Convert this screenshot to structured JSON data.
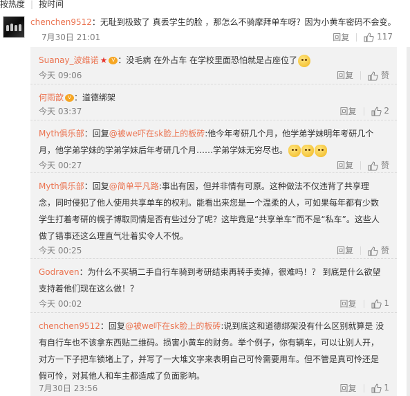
{
  "sort": {
    "by_hot": "按热度",
    "by_time": "按时间"
  },
  "main_comment": {
    "user": "chenchen9512",
    "text": "：无耻到极致了 真丢学生的脸 ，那怎么不骑摩拜单车呀？因为小黄车密码不会变。",
    "time": "7月30日 21:01",
    "reply_label": "回复",
    "likes": "117"
  },
  "replies": [
    {
      "user": "Suanay_波维诺",
      "badges": [
        "star-badge",
        "vip-badge"
      ],
      "text": "：没毛病 在外占车 在学校里面恐怕就是占座位了",
      "emoji_count": 1,
      "time": "今天 09:06",
      "reply_label": "回复",
      "likes_label": "赞"
    },
    {
      "user": "何雨歆",
      "badges": [
        "vip-badge"
      ],
      "text": "：道德绑架",
      "time": "今天 03:37",
      "reply_label": "回复",
      "likes_label": "2"
    },
    {
      "user": "Myth俱乐部",
      "reply_prefix": "：回复",
      "mention": "@被we吓在sk脸上的板砖",
      "text": ":他今年考研几个月，他学弟学妹明年考研几个月，他学弟学妹的学弟学妹后年考研几个月……学弟学妹无穷尽也。",
      "emoji_count": 3,
      "time": "今天 00:27",
      "reply_label": "回复",
      "likes_label": "赞"
    },
    {
      "user": "Myth俱乐部",
      "reply_prefix": "：回复",
      "mention": "@简单平凡路",
      "text": ":事出有因，但并非情有可原。这种做法不仅违背了共享理念，同时侵犯了他人使用共享单车的权利。能看出来您是一个温柔的人，可如果每年都有少数学生打着考研的幌子博取同情是否有些过分了呢？这毕竟是“共享单车”而不是“私车”。这些人做了错事还这么理直气壮着实令人不悦。",
      "time": "今天 00:25",
      "reply_label": "回复",
      "likes_label": "赞"
    },
    {
      "user": "Godraven",
      "text": "：为什么不买辆二手自行车骑到考研结束再转手卖掉，很难吗！？ 到底是什么欲望支持着他们现在这么做！？",
      "time": "今天 00:02",
      "reply_label": "回复",
      "likes_label": "1"
    },
    {
      "user": "chenchen9512",
      "reply_prefix": "：回复",
      "mention": "@被we吓在sk脸上的板砖",
      "text": ":说到底这和道德绑架没有什么区别就算是 没有自行车也不该拿东西贴二维码。损害小黄车的财务。举个例子，你有辆车，可以让别人开，对方一下子把车锁堵上了，并写了一大堆文字来表明自己可怜需要用车。但不管是真可怜还是假可怜，对其他人和车主都造成了负面影响。",
      "time": "7月30日 23:56",
      "reply_label": "回复",
      "likes_label": "1"
    }
  ],
  "colors": {
    "accent": "#eb7350",
    "meta": "#808080",
    "reply_bg": "#f2f2f2"
  }
}
